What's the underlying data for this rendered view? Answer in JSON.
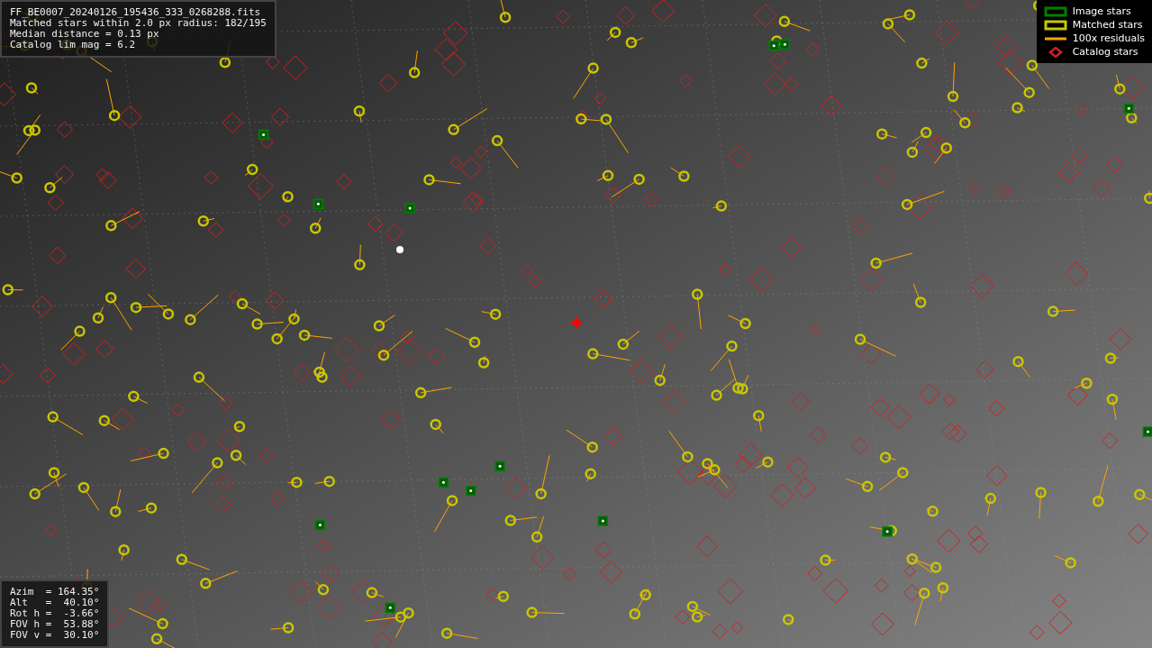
{
  "info_panel": {
    "lines": [
      "FF_BE0007_20240126_195436_333_0268288.fits",
      "Matched stars within 2.0 px radius: 182/195",
      "Median distance = 0.13 px",
      "Catalog lim mag = 6.2"
    ]
  },
  "pointing_panel": {
    "lines": [
      "Azim  = 164.35°",
      "Alt   =  40.10°",
      "Rot h =  -3.66°",
      "FOV h =  53.88°",
      "FOV v =  30.10°"
    ]
  },
  "legend": [
    {
      "kind": "square",
      "label": "Image stars",
      "color": "#008000"
    },
    {
      "kind": "square",
      "label": "Matched stars",
      "color": "#c8c800"
    },
    {
      "kind": "line",
      "label": "100x residuals",
      "color": "#ffa500"
    },
    {
      "kind": "diamond",
      "label": "Catalog stars",
      "color": "#d02020"
    }
  ]
}
